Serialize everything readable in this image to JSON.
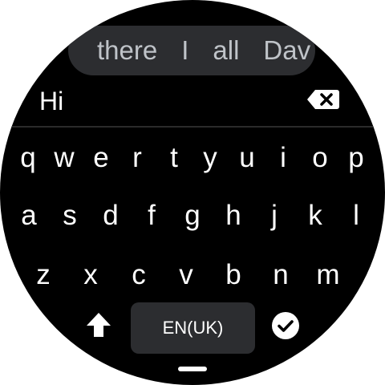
{
  "suggestions": [
    "there",
    "I",
    "all",
    "Dav"
  ],
  "input": {
    "text": "Hi"
  },
  "keyboard": {
    "row1": [
      "q",
      "w",
      "e",
      "r",
      "t",
      "y",
      "u",
      "i",
      "o",
      "p"
    ],
    "row2": [
      "a",
      "s",
      "d",
      "f",
      "g",
      "h",
      "j",
      "k",
      "l"
    ],
    "row3": [
      "z",
      "x",
      "c",
      "v",
      "b",
      "n",
      "m"
    ],
    "language_label": "EN(UK)"
  },
  "icons": {
    "backspace": "backspace-icon",
    "shift": "shift-arrow-icon",
    "enter": "check-circle-icon"
  },
  "colors": {
    "background": "#000000",
    "pill": "#2c2d30",
    "suggestion_text": "#bfc3c8",
    "key_text": "#ffffff"
  }
}
